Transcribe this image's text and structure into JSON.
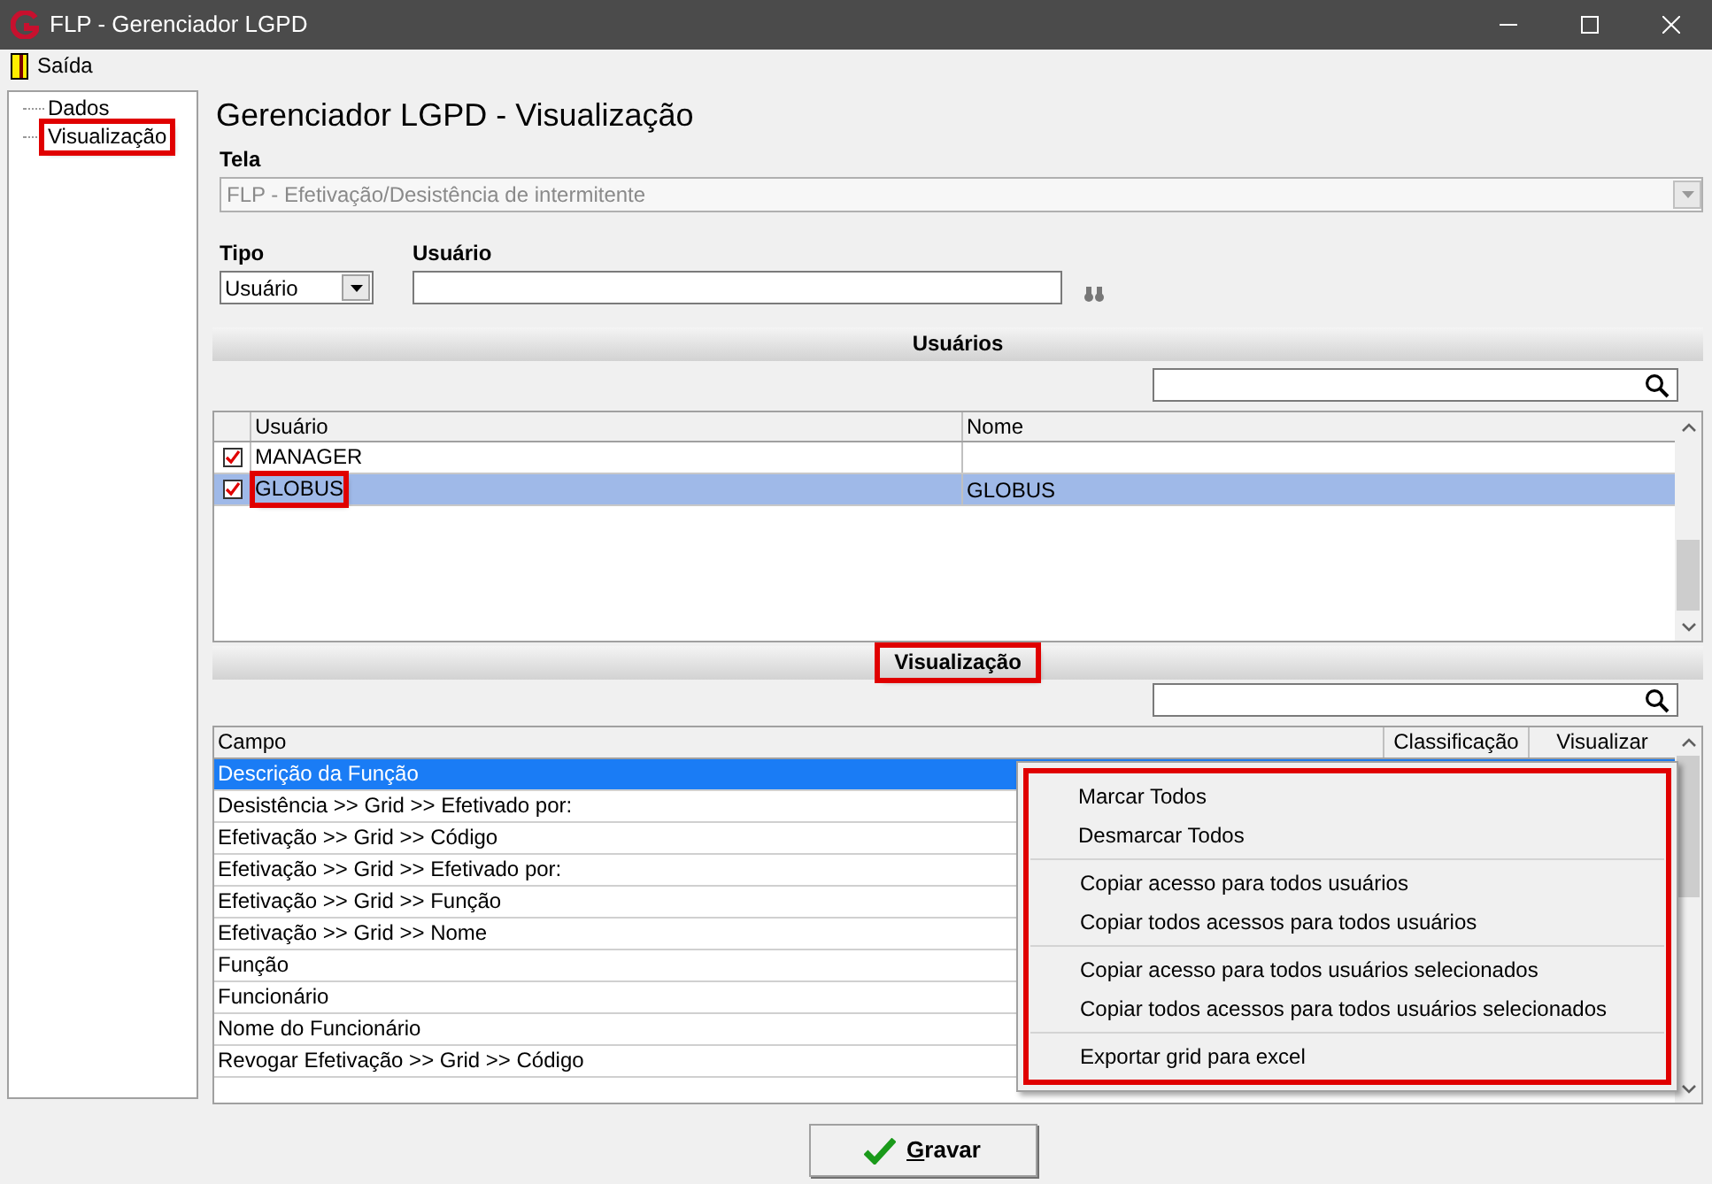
{
  "window": {
    "title": "FLP - Gerenciador LGPD"
  },
  "menu": [
    {
      "label": "Saída"
    }
  ],
  "tree": [
    {
      "label": "Dados",
      "highlighted": false
    },
    {
      "label": "Visualização",
      "highlighted": true
    }
  ],
  "heading": "Gerenciador LGPD - Visualização",
  "tela": {
    "label": "Tela",
    "value": "FLP - Efetivação/Desistência de intermitente",
    "disabled": true
  },
  "tipo": {
    "label": "Tipo",
    "value": "Usuário"
  },
  "usuario": {
    "label": "Usuário"
  },
  "users_section": {
    "title": "Usuários",
    "highlighted": false,
    "columns": [
      "Usuário",
      "Nome"
    ],
    "rows": [
      {
        "checked": true,
        "selected": false,
        "highlighted": false,
        "cells": [
          "MANAGER",
          ""
        ]
      },
      {
        "checked": true,
        "selected": true,
        "highlighted": true,
        "cells": [
          "GLOBUS",
          "GLOBUS"
        ]
      }
    ]
  },
  "fields_section": {
    "title": "Visualização",
    "highlighted": true,
    "columns": [
      "Campo",
      "Classificação",
      "Visualizar"
    ],
    "rows": [
      {
        "selected": true,
        "cells": [
          "Descrição da Função"
        ]
      },
      {
        "selected": false,
        "cells": [
          "Desistência >> Grid >> Efetivado por:"
        ]
      },
      {
        "selected": false,
        "cells": [
          "Efetivação >> Grid >> Código"
        ]
      },
      {
        "selected": false,
        "cells": [
          "Efetivação >> Grid >> Efetivado por:"
        ]
      },
      {
        "selected": false,
        "cells": [
          "Efetivação >> Grid >> Função"
        ]
      },
      {
        "selected": false,
        "cells": [
          "Efetivação >> Grid >> Nome"
        ]
      },
      {
        "selected": false,
        "cells": [
          "Função"
        ]
      },
      {
        "selected": false,
        "cells": [
          "Funcionário"
        ]
      },
      {
        "selected": false,
        "cells": [
          "Nome do Funcionário"
        ]
      },
      {
        "selected": false,
        "cells": [
          "Revogar Efetivação >> Grid >> Código"
        ]
      }
    ]
  },
  "context_menu": {
    "highlighted": true,
    "groups": [
      [
        "Marcar Todos",
        "Desmarcar Todos"
      ],
      [
        "Copiar acesso para todos usuários",
        "Copiar todos acessos para todos usuários"
      ],
      [
        "Copiar acesso para todos usuários selecionados",
        "Copiar todos acessos para todos usuários selecionados"
      ],
      [
        "Exportar grid para excel"
      ]
    ]
  },
  "save_button": {
    "label": "Gravar"
  }
}
